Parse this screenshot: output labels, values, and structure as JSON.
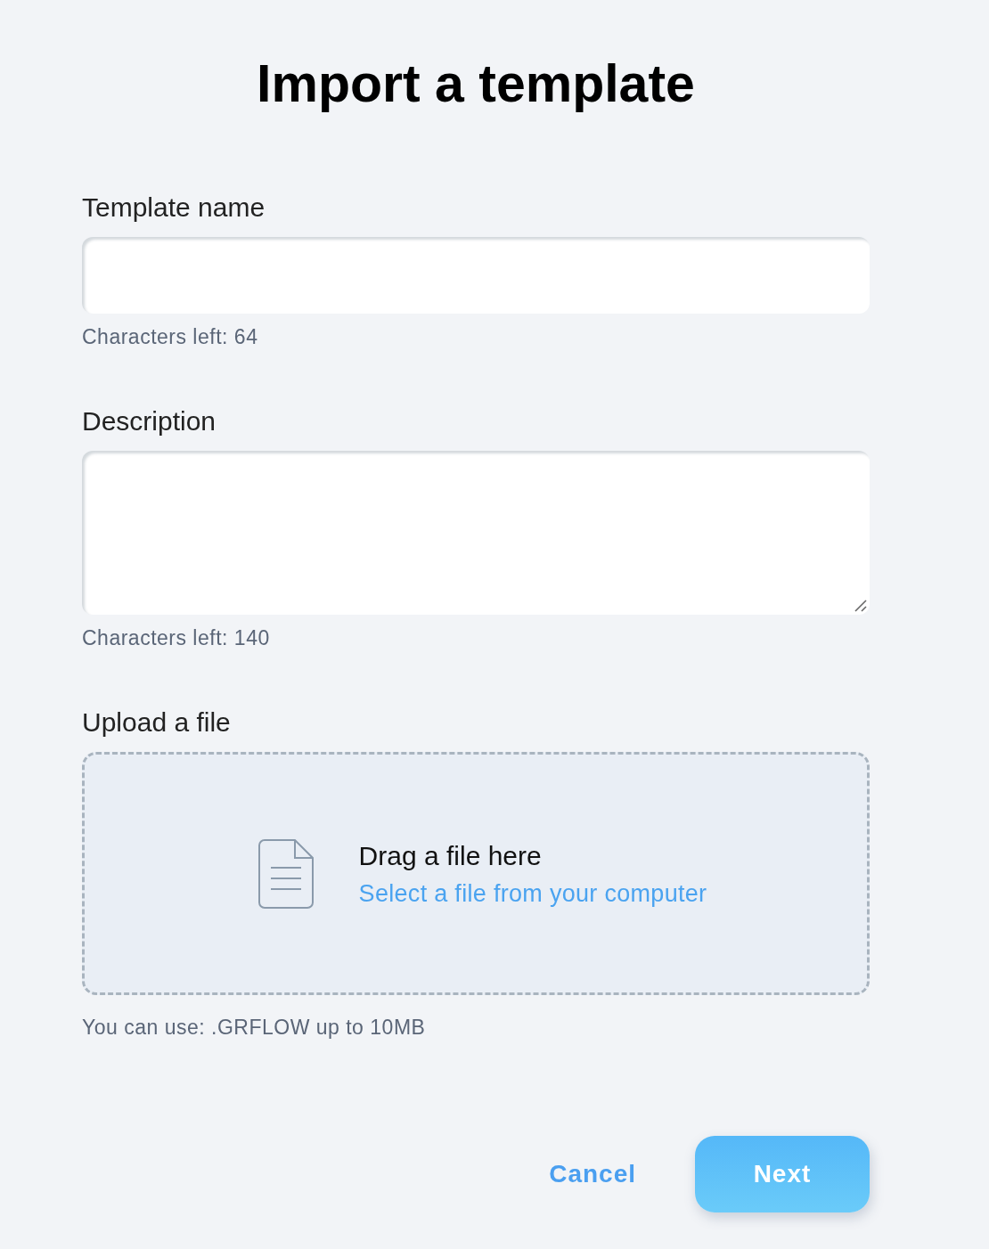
{
  "title": "Import a template",
  "fields": [
    {
      "kind": "input",
      "label": "Template name",
      "counter": "Characters left: 64"
    },
    {
      "kind": "textarea",
      "label": "Description",
      "counter": "Characters left: 140"
    }
  ],
  "upload": {
    "label": "Upload a file",
    "prompt": "Drag a file here",
    "link": "Select a file from your computer",
    "hint": "You can use: .GRFLOW up to 10MB"
  },
  "buttons": [
    {
      "kind": "text",
      "label": "Cancel"
    },
    {
      "kind": "primary",
      "label": "Next"
    }
  ]
}
